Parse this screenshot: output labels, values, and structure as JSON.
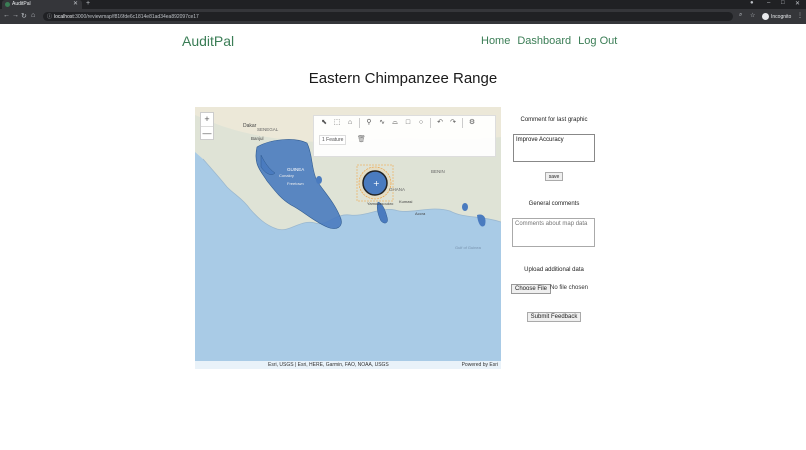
{
  "browser": {
    "tab_title": "AuditPal",
    "url_host": "localhost",
    "url_path": ":3000/reviewmap/f816fde6c1814e81ad34ea892097ce17",
    "profile_label": "Incognito"
  },
  "header": {
    "brand": "AuditPal",
    "nav": [
      "Home",
      "Dashboard",
      "Log Out"
    ]
  },
  "page": {
    "title": "Eastern Chimpanzee Range"
  },
  "map": {
    "zoom_in": "+",
    "zoom_out": "—",
    "feature_count": "1 Feature",
    "labels": [
      "Dakar",
      "SENEGAL",
      "Banjul",
      "GUINEA",
      "Conakry",
      "Freetown",
      "GHANA",
      "Kumasi",
      "Accra",
      "BENIN",
      "Yamoussoukro",
      "Gulf of Guinea"
    ],
    "attribution": "Esri, USGS | Esri, HERE, Garmin, FAO, NOAA, USGS",
    "powered_by": "Powered by Esri"
  },
  "panel": {
    "comment_label": "Comment for last graphic",
    "comment_value": "Improve Accuracy",
    "save_label": "save",
    "general_label": "General comments",
    "general_placeholder": "Comments about map data",
    "upload_label": "Upload additional data",
    "choose_file_label": "Choose File",
    "file_status": "No file chosen",
    "submit_label": "Submit Feedback"
  },
  "colors": {
    "brand": "#3a7d55",
    "range_fill": "#4a7bbf",
    "ocean": "#a9cbe6"
  }
}
